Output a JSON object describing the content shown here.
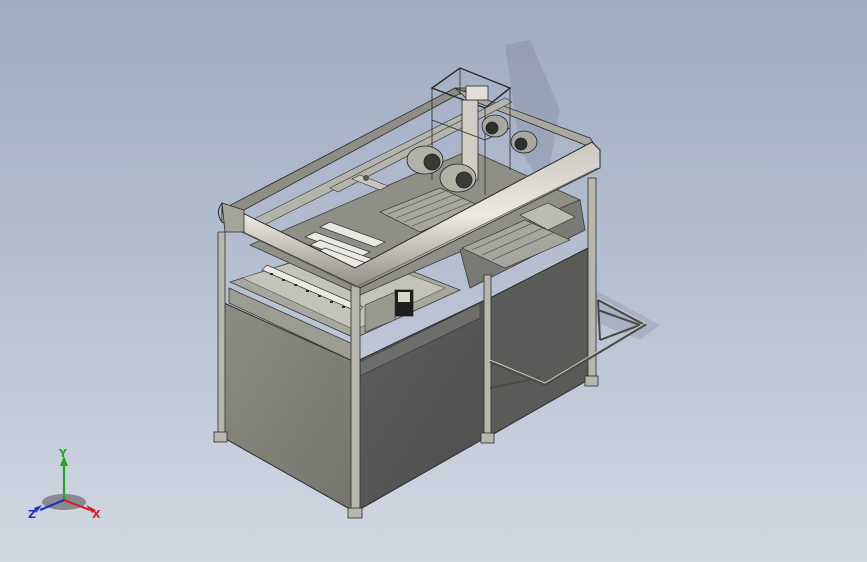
{
  "view": {
    "background_top": "#9fabc1",
    "background_bottom": "#d2d8e3"
  },
  "triad": {
    "x_label": "X",
    "y_label": "Y",
    "z_label": "Z",
    "x_color": "#d42020",
    "y_color": "#1fa51f",
    "z_color": "#2030c8"
  }
}
